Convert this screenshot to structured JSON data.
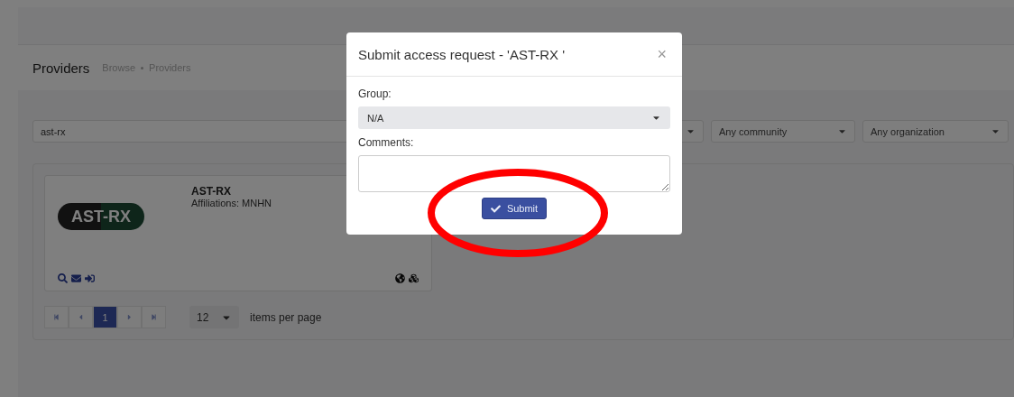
{
  "page": {
    "title": "Providers",
    "breadcrumb": [
      "Browse",
      "Providers"
    ]
  },
  "filters": {
    "search": {
      "value": "ast-rx"
    },
    "selects": [
      {
        "label": "Any community"
      },
      {
        "label": "Any organization"
      }
    ]
  },
  "provider_card": {
    "logo": "AST-RX",
    "name": "AST-RX",
    "affiliations": "Affiliations: MNHN"
  },
  "pagination": {
    "pages": [
      {
        "label": "1",
        "selected": true
      }
    ],
    "page_size": "12",
    "page_size_label": "items per page"
  },
  "modal": {
    "title": "Submit access request - 'AST-RX '",
    "close": "×",
    "group_label": "Group:",
    "group_value": "N/A",
    "comments_label": "Comments:",
    "submit": "Submit"
  },
  "annotation": {
    "kind": "ellipse"
  }
}
